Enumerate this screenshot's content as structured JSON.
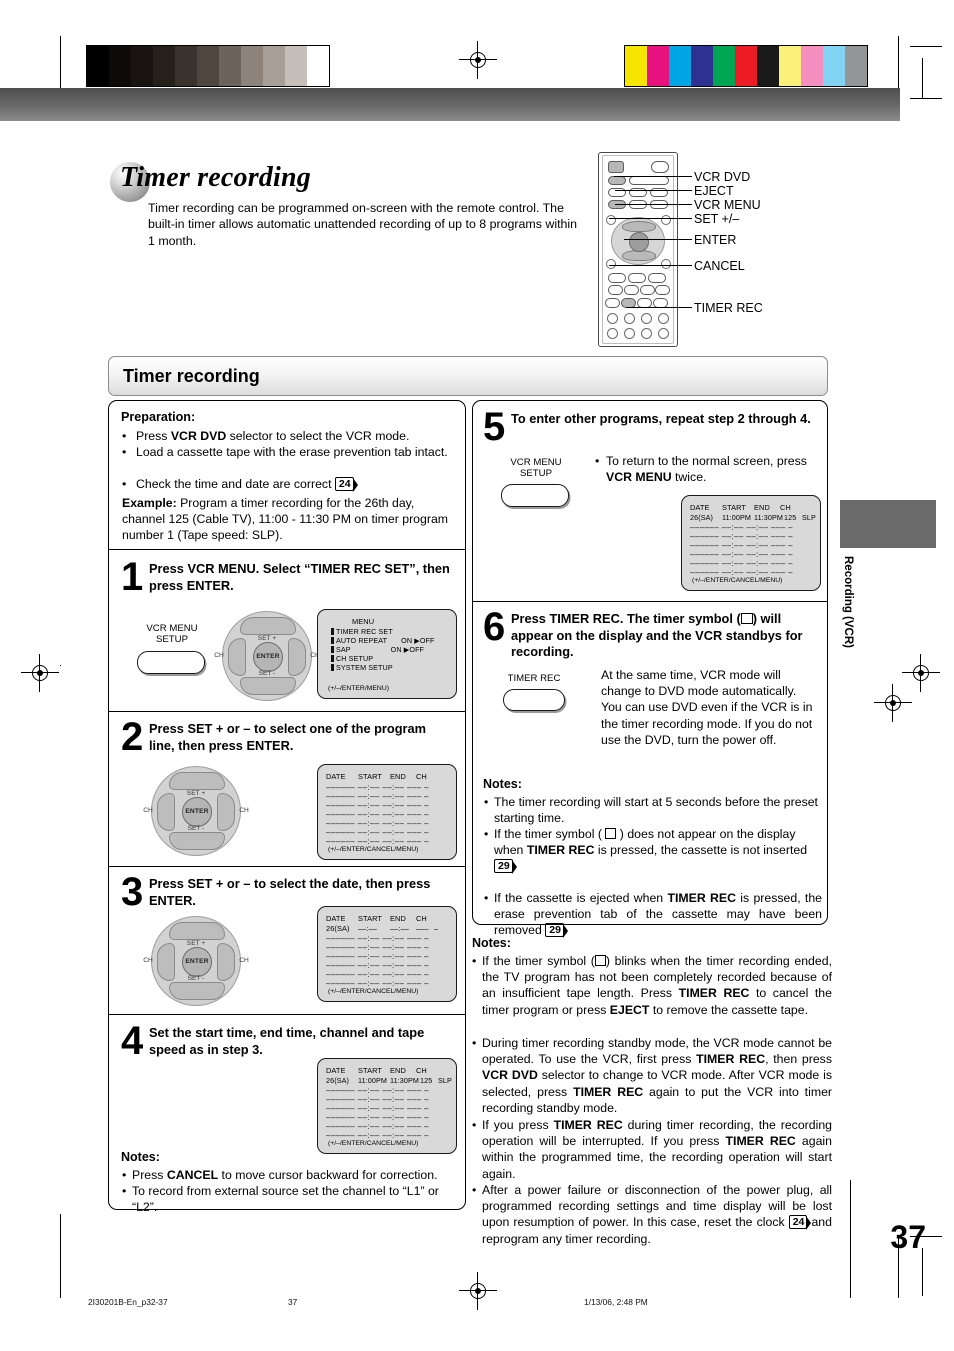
{
  "document": {
    "title": "Timer recording",
    "intro": "Timer recording can be programmed on-screen with the remote control. The built-in timer allows automatic unattended recording of up to 8 programs within 1 month.",
    "section_header": "Timer recording",
    "page_number": "37",
    "side_tab": "Recording (VCR)"
  },
  "remote_callouts": [
    {
      "label": "VCR DVD"
    },
    {
      "label": "EJECT"
    },
    {
      "label": "VCR MENU"
    },
    {
      "label": "SET +/–"
    },
    {
      "label": "ENTER"
    },
    {
      "label": "CANCEL"
    },
    {
      "label": "TIMER REC"
    }
  ],
  "preparation": {
    "heading": "Preparation:",
    "bullets": [
      "Press VCR DVD selector to select the VCR mode.",
      "Load a cassette tape with the erase prevention tab intact.",
      "Check the time and date are correct 24."
    ],
    "example_label": "Example:",
    "example_text": "Program a timer recording for the 26th day, channel 125 (Cable TV), 11:00 - 11:30 PM on timer program number 1 (Tape speed: SLP).",
    "ref": "24"
  },
  "steps": [
    {
      "num": "1",
      "text": "Press VCR MENU. Select “TIMER REC SET”, then press ENTER.",
      "button_label": "VCR MENU\nSETUP",
      "button_line1": "VCR MENU",
      "button_line2": "SETUP"
    },
    {
      "num": "2",
      "text": "Press SET + or – to select one of the program line, then press ENTER."
    },
    {
      "num": "3",
      "text": "Press SET + or – to select the date, then press ENTER."
    },
    {
      "num": "4",
      "text": "Set the start time, end time, channel and tape speed as in step 3."
    },
    {
      "num": "5",
      "text": "To enter other programs, repeat step 2 through 4.",
      "button_line1": "VCR MENU",
      "button_line2": "SETUP",
      "bullet": "To return to the normal screen, press VCR MENU twice."
    },
    {
      "num": "6",
      "text": "Press TIMER REC. The timer symbol (□) will appear on the display and the VCR standbys for recording.",
      "button_line1": "TIMER REC",
      "body": "At the same time, VCR mode will change to DVD mode automatically. You can use DVD even if the VCR is in the timer recording mode. If you do not use the DVD, turn the power off."
    }
  ],
  "osd_menu": {
    "title": "MENU",
    "items": [
      {
        "label": "TIMER REC SET",
        "value": ""
      },
      {
        "label": "AUTO REPEAT",
        "value": "ON ▶OFF"
      },
      {
        "label": "SAP",
        "value": "ON ▶OFF"
      },
      {
        "label": "CH SETUP",
        "value": ""
      },
      {
        "label": "SYSTEM SETUP",
        "value": ""
      }
    ],
    "footer": "(+/–/ENTER/MENU)"
  },
  "osd_timer": {
    "headers": [
      "DATE",
      "START",
      "END",
      "CH"
    ],
    "empty_row": "––––––  ––:––   ––:––  –––  –",
    "footer": "(+/–/ENTER/CANCEL/MENU)",
    "row_step3": {
      "date": "26(SA)",
      "start": "––:––",
      "end": "––:––",
      "ch": "–––",
      "speed": "–"
    },
    "row_step4": {
      "date": "26(SA)",
      "start": "11:00PM",
      "end": "11:30PM",
      "ch": "125",
      "speed": "SLP"
    }
  },
  "notes_step4": {
    "heading": "Notes:",
    "bullets": [
      "Press CANCEL to move cursor backward for correction.",
      "To record from external source set the channel to “L1” or “L2”."
    ]
  },
  "notes_step6": {
    "heading": "Notes:",
    "bullets": [
      "The timer recording will start at 5 seconds before the preset starting time.",
      "If the timer symbol ( □ ) does not appear on the display when TIMER REC is pressed, the cassette is not inserted 29.",
      "If the cassette is ejected when TIMER REC is pressed, the erase prevention tab of the cassette may have been removed 29."
    ],
    "ref": "29"
  },
  "notes_bottom": {
    "heading": "Notes:",
    "bullets": [
      "If the timer symbol (□) blinks when the timer recording ended, the TV program has not been completely recorded because of an insufficient tape length. Press TIMER REC to cancel the timer program or press EJECT to remove the cassette tape.",
      "During timer recording standby mode, the VCR mode cannot be operated. To use the VCR, first press TIMER REC, then press VCR DVD selector to change to VCR mode. After VCR mode is selected, press TIMER REC again to put the VCR into timer recording standby mode.",
      "If you press TIMER REC during timer recording, the recording operation will be interrupted. If you press TIMER REC again within the programmed time, the recording operation will start again.",
      "After a power failure or disconnection of the power plug, all programmed recording settings and time display will be lost upon resumption of power. In this case, reset the clock 24 and reprogram any timer recording."
    ],
    "ref": "24"
  },
  "footer": {
    "doc_id": "2I30201B-En_p32-37",
    "page": "37",
    "timestamp": "1/13/06, 2:48 PM"
  },
  "colors": {
    "grayscale_bar": [
      "#000000",
      "#0d0a08",
      "#191410",
      "#26201b",
      "#3a322c",
      "#4f463f",
      "#6d635b",
      "#8d837b",
      "#a79e97",
      "#c6bfb9",
      "#ffffff"
    ],
    "color_bar": [
      "#f5e500",
      "#e8127f",
      "#00a5e3",
      "#2e3192",
      "#00a651",
      "#ed1c24",
      "#1a1a1a",
      "#fbf07a",
      "#f48fc0",
      "#82d4f5",
      "#939598"
    ],
    "tab_gray": "#6b6b6b"
  }
}
